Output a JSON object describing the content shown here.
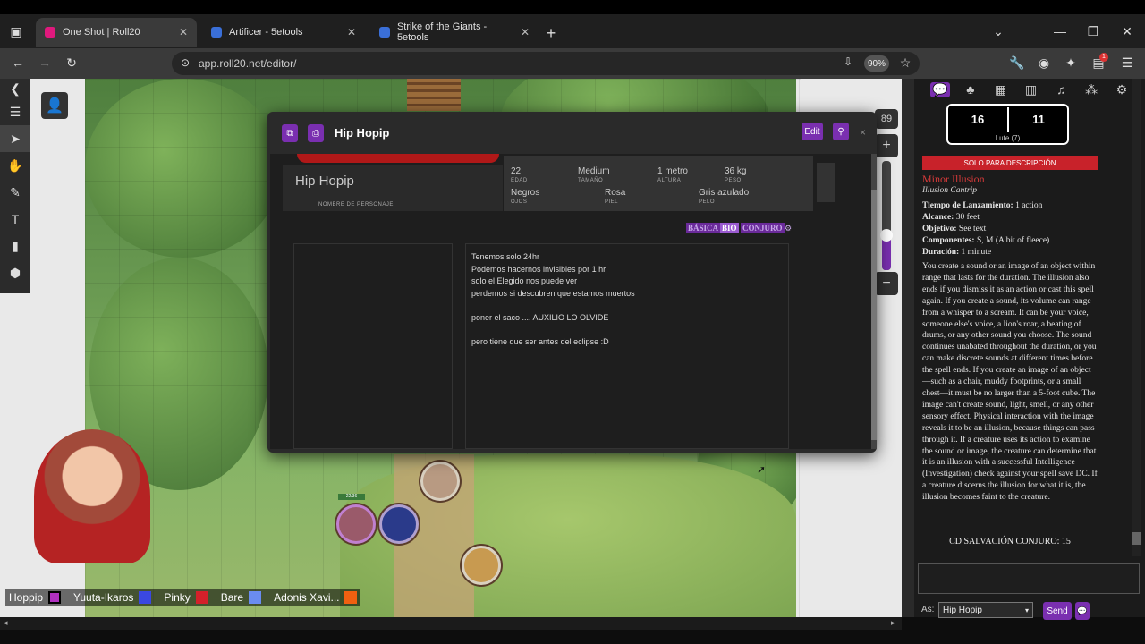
{
  "browser": {
    "tabs": [
      {
        "title": "One Shot | Roll20",
        "active": true
      },
      {
        "title": "Artificer - 5etools",
        "active": false
      },
      {
        "title": "Strike of the Giants - 5etools",
        "active": false
      }
    ],
    "url": "app.roll20.net/editor/",
    "zoom": "90%",
    "badge": "1"
  },
  "vtt": {
    "layer_number": "89",
    "players": [
      {
        "name": "Hoppip",
        "color": "#b030c0"
      },
      {
        "name": "Yuuta-Ikaros",
        "color": "#3a48e0"
      },
      {
        "name": "Pinky",
        "color": "#d4202a"
      },
      {
        "name": "Bare",
        "color": "#6a8cf0"
      },
      {
        "name": "Adonis Xavi...",
        "color": "#f06010"
      }
    ],
    "token_hp": "22/36"
  },
  "dialog": {
    "title": "Hip Hopip",
    "edit_label": "Edit",
    "close": "×",
    "char_name": "Hip Hopip",
    "char_name_label": "NOMBRE DE PERSONAJE",
    "stats": [
      {
        "value": "22",
        "label": "EDAD"
      },
      {
        "value": "Medium",
        "label": "TAMAÑO"
      },
      {
        "value": "1 metro",
        "label": "ALTURA"
      },
      {
        "value": "36 kg",
        "label": "PESO"
      },
      {
        "value": "Negros",
        "label": "OJOS"
      },
      {
        "value": "Rosa",
        "label": "PIEL"
      },
      {
        "value": "Gris azulado",
        "label": "PELO"
      }
    ],
    "tabs": [
      "BÁSICA",
      "BIO",
      "CONJURO"
    ],
    "notes": [
      "Tenemos solo 24hr",
      "Podemos hacernos invisibles por 1 hr",
      "solo el Elegido nos puede ver",
      "perdemos si descubren que estamos muertos",
      "",
      "poner el saco .... AUXILIO  LO OLVIDE",
      "",
      "pero tiene que ser antes del eclipse :D"
    ]
  },
  "chat": {
    "roll_left": "16",
    "roll_right": "11",
    "roll_label": "Lute (7)",
    "banner": "SOLO PARA DESCRIPCIÓN",
    "spell_name": "Minor Illusion",
    "spell_type": "Illusion Cantrip",
    "fields": [
      {
        "k": "Tiempo de Lanzamiento:",
        "v": "1 action"
      },
      {
        "k": "Alcance:",
        "v": "30 feet"
      },
      {
        "k": "Objetivo:",
        "v": "See text"
      },
      {
        "k": "Componentes:",
        "v": "S, M (A bit of fleece)"
      },
      {
        "k": "Duración:",
        "v": "1 minute"
      }
    ],
    "description": "You create a sound or an image of an object within range that lasts for the duration. The illusion also ends if you dismiss it as an action or cast this spell again. If you create a sound, its volume can range from a whisper to a scream. It can be your voice, someone else's voice, a lion's roar, a beating of drums, or any other sound you choose. The sound continues unabated throughout the duration, or you can make discrete sounds at different times before the spell ends. If you create an image of an object—such as a chair, muddy footprints, or a small chest—it must be no larger than a 5-foot cube. The image can't create sound, light, smell, or any other sensory effect. Physical interaction with the image reveals it to be an illusion, because things can pass through it. If a creature uses its action to examine the sound or image, the creature can determine that it is an illusion with a successful Intelligence (Investigation) check against your spell save DC. If a creature discerns the illusion for what it is, the illusion becomes faint to the creature.",
    "save_dc": "CD SALVACIÓN CONJURO: 15",
    "as_label": "As:",
    "as_value": "Hip Hopip",
    "send_label": "Send"
  }
}
